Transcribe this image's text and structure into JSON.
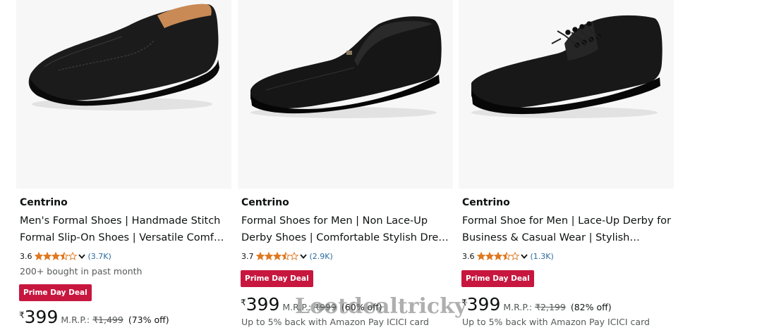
{
  "products": [
    {
      "brand": "Centrino",
      "title": "Men's Formal Shoes | Handmade Stitch Formal Slip-On Shoes | Versatile Comf…",
      "rating": "3.6",
      "stars": 3.5,
      "review_count": "(3.7K)",
      "bought": "200+ bought in past month",
      "badge": "Prime Day Deal",
      "currency": "₹",
      "price": "399",
      "mrp_label": "M.R.P.:",
      "mrp": "₹1,499",
      "discount": "(73% off)",
      "cashback": "",
      "image_icon": "slip-on-shoe-icon"
    },
    {
      "brand": "Centrino",
      "title": "Formal Shoes for Men | Non Lace-Up Derby Shoes | Comfortable Stylish Dre…",
      "rating": "3.7",
      "stars": 3.5,
      "review_count": "(2.9K)",
      "bought": "",
      "badge": "Prime Day Deal",
      "currency": "₹",
      "price": "399",
      "mrp_label": "M.R.P.:",
      "mrp": "₹999",
      "discount": "(60% off)",
      "cashback": "Up to 5% back with Amazon Pay ICICI card",
      "image_icon": "slip-on-shoe-icon"
    },
    {
      "brand": "Centrino",
      "title": "Formal Shoe for Men | Lace-Up Derby for Business & Casual Wear | Stylish Desig…",
      "rating": "3.6",
      "stars": 3.5,
      "review_count": "(1.3K)",
      "bought": "",
      "badge": "Prime Day Deal",
      "currency": "₹",
      "price": "399",
      "mrp_label": "M.R.P.:",
      "mrp": "₹2,199",
      "discount": "(82% off)",
      "cashback": "Up to 5% back with Amazon Pay ICICI card",
      "image_icon": "lace-up-shoe-icon"
    }
  ],
  "watermark": "Lootdealtricky",
  "colors": {
    "star": "#de7921",
    "badge": "#c7173f",
    "link": "#2a6b9e",
    "image_bg": "#f7f7f7"
  }
}
